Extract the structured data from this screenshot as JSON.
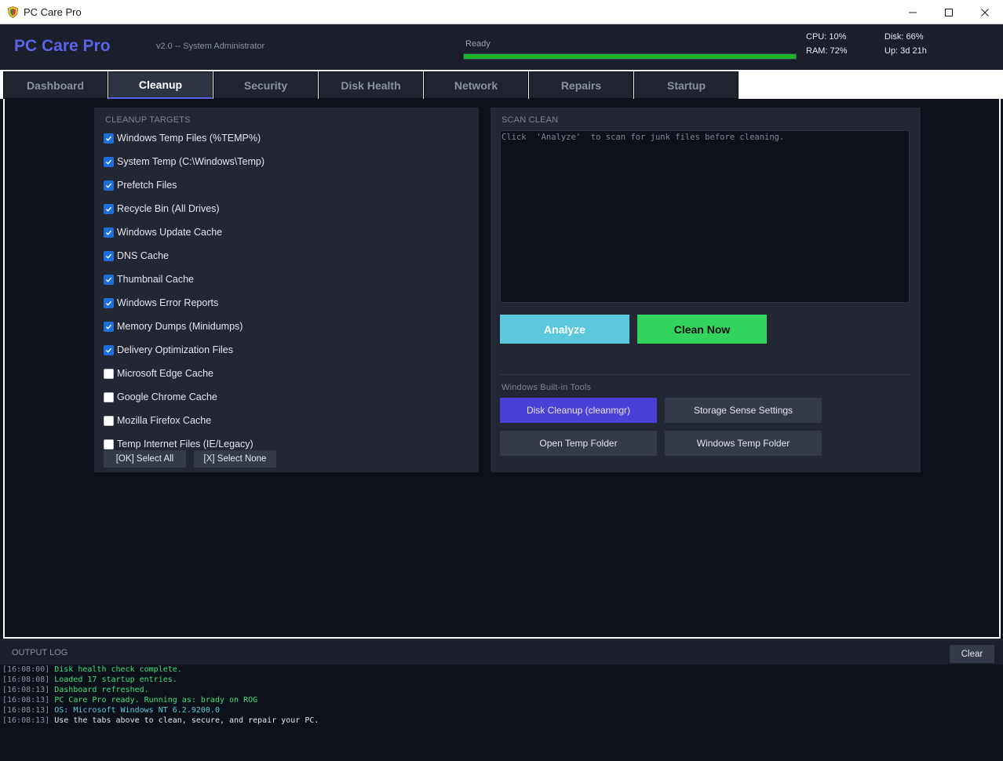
{
  "window": {
    "title": "PC Care Pro"
  },
  "header": {
    "app_name": "PC Care Pro",
    "subtitle": "v2.0  --  System Administrator",
    "status": "Ready",
    "progress": 1.0,
    "cpu": "CPU: 10%",
    "ram": "RAM: 72%",
    "disk": "Disk: 66%",
    "uptime": "Up: 3d 21h"
  },
  "tabs": [
    {
      "label": "Dashboard",
      "active": false
    },
    {
      "label": "Cleanup",
      "active": true
    },
    {
      "label": "Security",
      "active": false
    },
    {
      "label": "Disk Health",
      "active": false
    },
    {
      "label": "Network",
      "active": false
    },
    {
      "label": "Repairs",
      "active": false
    },
    {
      "label": "Startup",
      "active": false
    }
  ],
  "targets": {
    "title": "CLEANUP TARGETS",
    "items": [
      {
        "label": "Windows Temp Files (%TEMP%)",
        "checked": true
      },
      {
        "label": "System Temp (C:\\Windows\\Temp)",
        "checked": true
      },
      {
        "label": "Prefetch Files",
        "checked": true
      },
      {
        "label": "Recycle Bin (All Drives)",
        "checked": true
      },
      {
        "label": "Windows Update Cache",
        "checked": true
      },
      {
        "label": "DNS Cache",
        "checked": true
      },
      {
        "label": "Thumbnail Cache",
        "checked": true
      },
      {
        "label": "Windows Error Reports",
        "checked": true
      },
      {
        "label": "Memory Dumps (Minidumps)",
        "checked": true
      },
      {
        "label": "Delivery Optimization Files",
        "checked": true
      },
      {
        "label": "Microsoft Edge Cache",
        "checked": false
      },
      {
        "label": "Google Chrome Cache",
        "checked": false
      },
      {
        "label": "Mozilla Firefox Cache",
        "checked": false
      },
      {
        "label": "Temp Internet Files (IE/Legacy)",
        "checked": false
      }
    ],
    "select_all": "[OK] Select All",
    "select_none": "[X] Select None"
  },
  "scan": {
    "title": "SCAN  CLEAN",
    "output": "Click  'Analyze'  to scan for junk files before cleaning.",
    "analyze": "Analyze",
    "clean": "Clean Now",
    "tools_title": "Windows Built-in Tools",
    "tools": [
      {
        "label": "Disk Cleanup (cleanmgr)",
        "primary": true
      },
      {
        "label": "Storage Sense Settings",
        "primary": false
      },
      {
        "label": "Open Temp Folder",
        "primary": false
      },
      {
        "label": "Windows Temp Folder",
        "primary": false
      }
    ]
  },
  "log": {
    "title": "OUTPUT LOG",
    "clear": "Clear",
    "lines": [
      {
        "ts": "[16:08:00]",
        "msg": "Disk health check complete.",
        "color": "#3ee07a"
      },
      {
        "ts": "[16:08:08]",
        "msg": "Loaded 17 startup entries.",
        "color": "#3ee07a"
      },
      {
        "ts": "[16:08:13]",
        "msg": "Dashboard refreshed.",
        "color": "#3ee07a"
      },
      {
        "ts": "[16:08:13]",
        "msg": "PC Care Pro ready. Running as: brady on ROG",
        "color": "#3ee07a"
      },
      {
        "ts": "[16:08:13]",
        "msg": "OS: Microsoft Windows NT 6.2.9200.0",
        "color": "#5bc8dd"
      },
      {
        "ts": "[16:08:13]",
        "msg": "Use the tabs above to clean, secure, and repair your PC.",
        "color": "#e6e8ee"
      }
    ]
  },
  "colors": {
    "accent": "#5a64e8",
    "analyze": "#5bc8dd",
    "clean": "#33d45d",
    "checkbox": "#1e6fd9",
    "progress": "#1bb52a"
  }
}
